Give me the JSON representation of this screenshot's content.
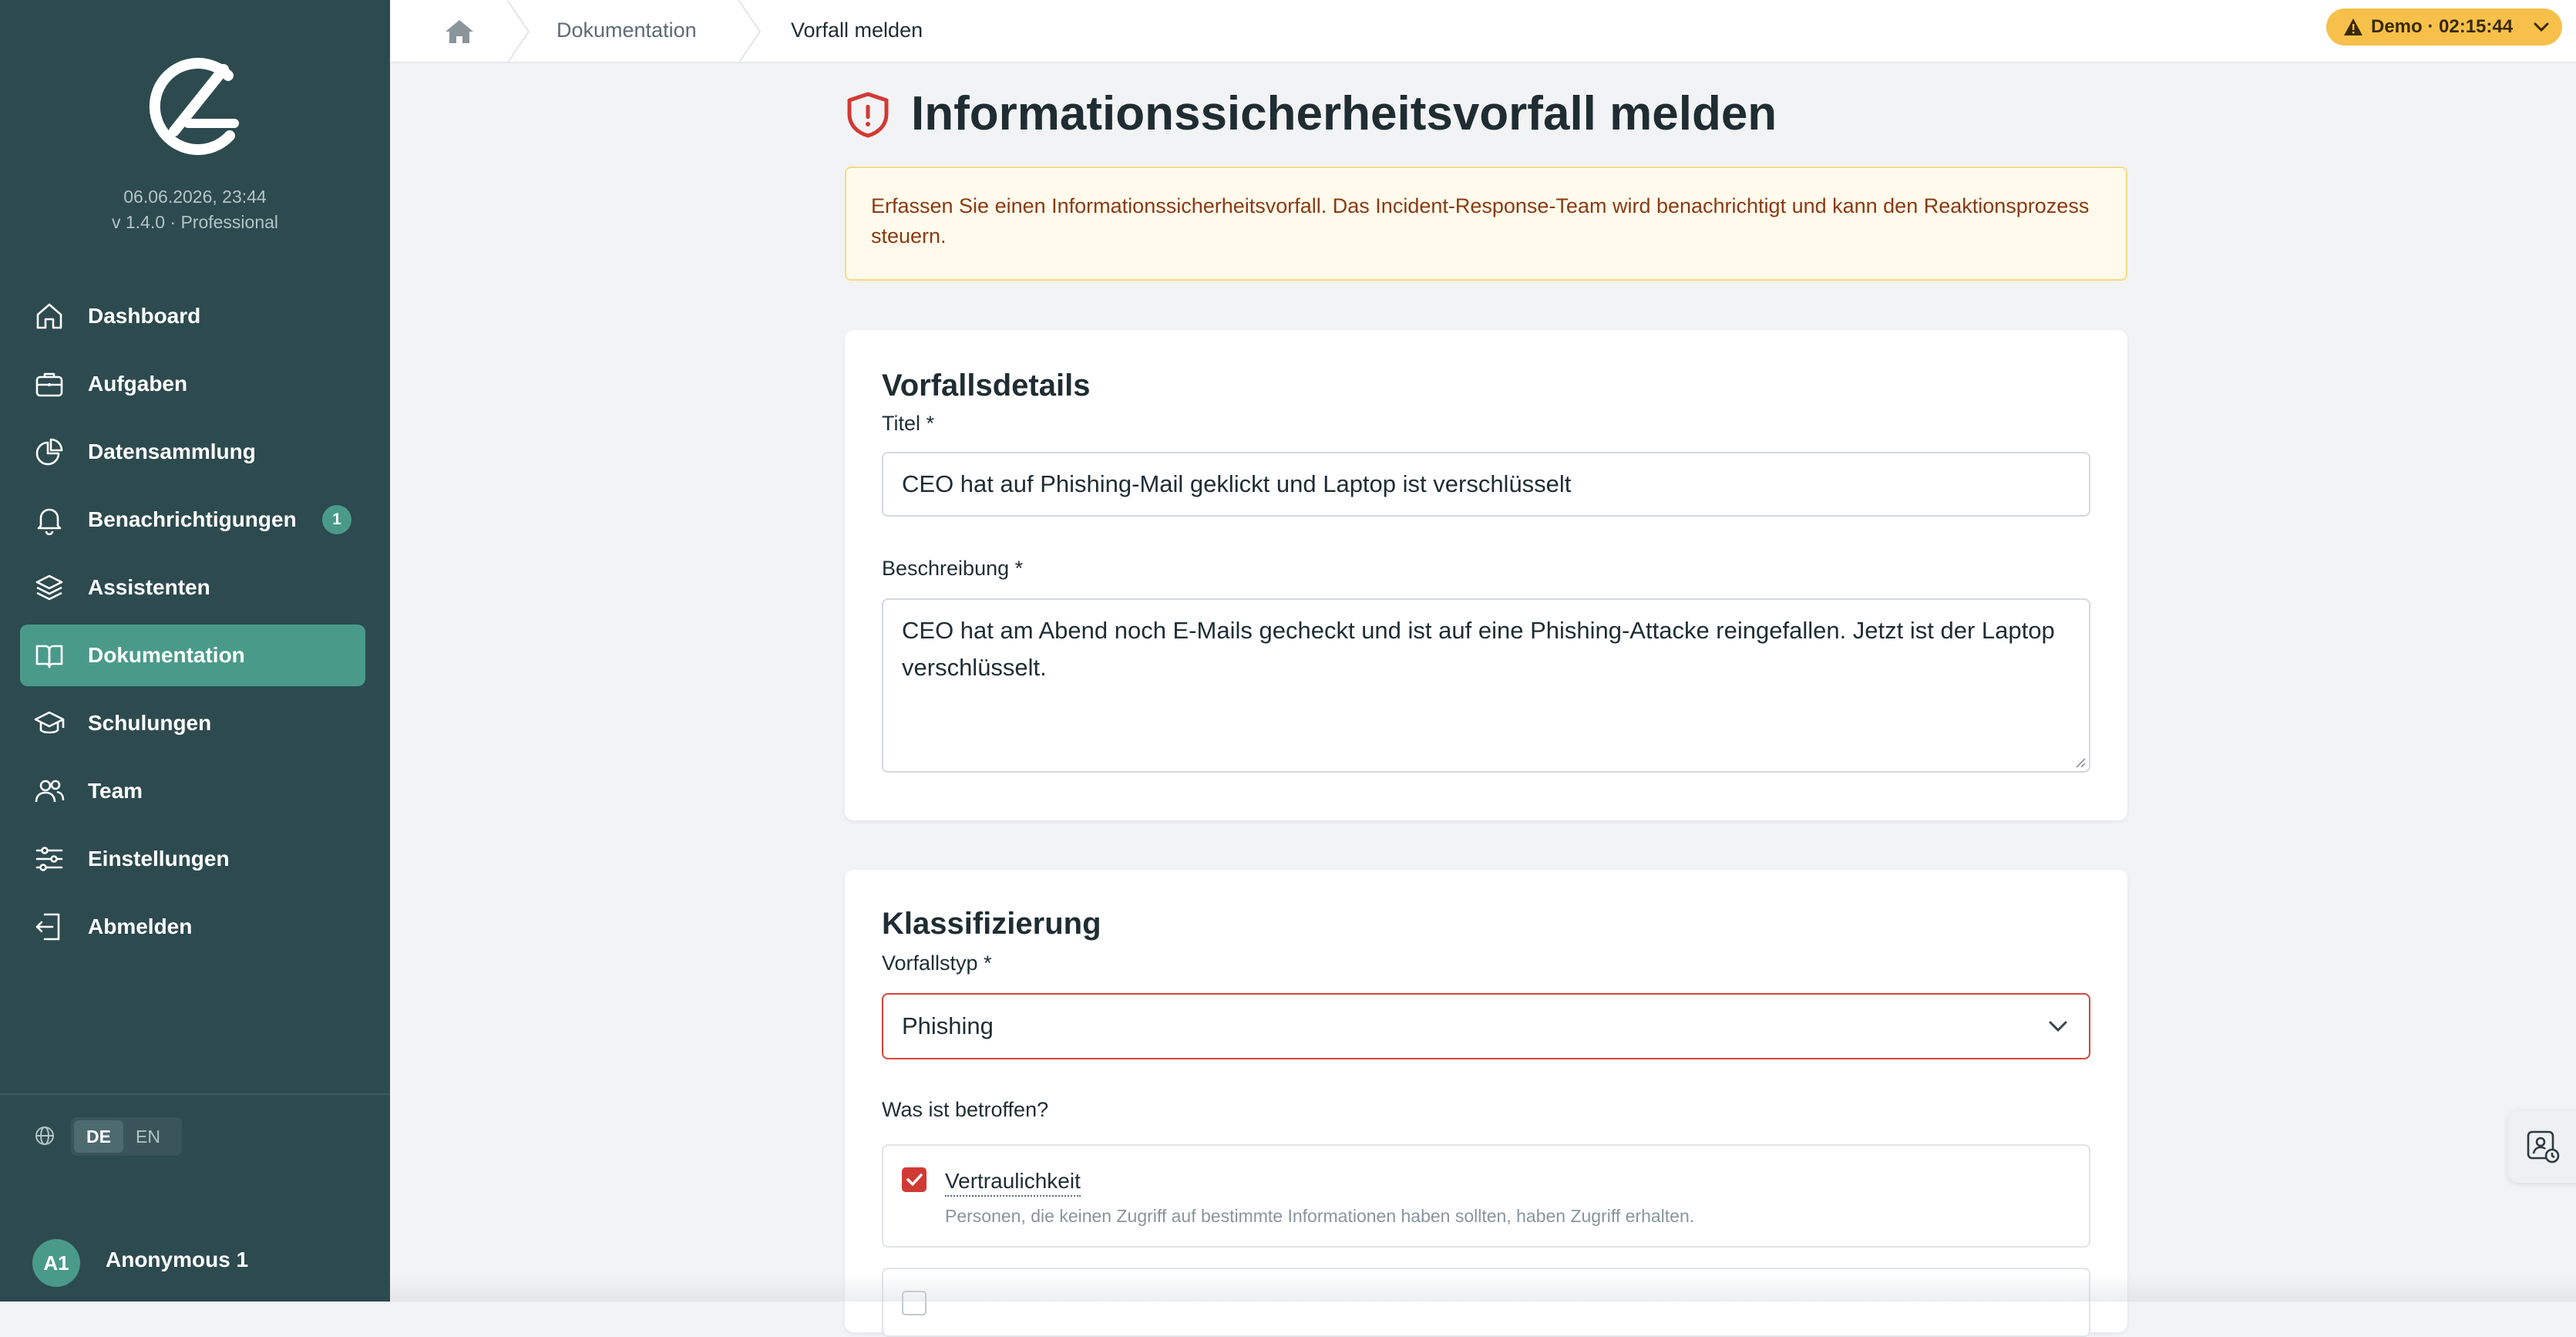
{
  "sidebar": {
    "datetime": "06.06.2026, 23:44",
    "version": "v 1.4.0 · Professional",
    "items": [
      {
        "label": "Dashboard",
        "icon": "home-icon"
      },
      {
        "label": "Aufgaben",
        "icon": "briefcase-icon"
      },
      {
        "label": "Datensammlung",
        "icon": "pie-chart-icon"
      },
      {
        "label": "Benachrichtigungen",
        "icon": "bell-icon",
        "badge": "1"
      },
      {
        "label": "Assistenten",
        "icon": "layers-icon"
      },
      {
        "label": "Dokumentation",
        "icon": "book-icon",
        "active": true
      },
      {
        "label": "Schulungen",
        "icon": "graduation-cap-icon"
      },
      {
        "label": "Team",
        "icon": "users-icon"
      },
      {
        "label": "Einstellungen",
        "icon": "sliders-icon"
      },
      {
        "label": "Abmelden",
        "icon": "logout-icon"
      }
    ],
    "languages": [
      "DE",
      "EN"
    ],
    "active_language": "DE",
    "user": {
      "initials": "A1",
      "name": "Anonymous 1"
    }
  },
  "topbar": {
    "breadcrumb": [
      "Dokumentation",
      "Vorfall melden"
    ],
    "demo_label": "Demo · 02:15:44"
  },
  "page": {
    "title": "Informationssicherheitsvorfall melden",
    "alert": "Erfassen Sie einen Informationssicherheitsvorfall. Das Incident-Response-Team wird benachrichtigt und kann den Reaktionsprozess steuern."
  },
  "details": {
    "heading": "Vorfallsdetails",
    "title_label": "Titel *",
    "title_value": "CEO hat auf Phishing-Mail geklickt und Laptop ist verschlüsselt",
    "description_label": "Beschreibung *",
    "description_value": "CEO hat am Abend noch E-Mails gecheckt und ist auf eine Phishing-Attacke reingefallen. Jetzt ist der Laptop verschlüsselt."
  },
  "classification": {
    "heading": "Klassifizierung",
    "type_label": "Vorfallstyp *",
    "type_value": "Phishing",
    "affected_label": "Was ist betroffen?",
    "options": [
      {
        "title": "Vertraulichkeit",
        "description": "Personen, die keinen Zugriff auf bestimmte Informationen haben sollten, haben Zugriff erhalten.",
        "checked": true
      }
    ]
  },
  "colors": {
    "sidebar_bg": "#2d4a4f",
    "accent": "#4a9a8a",
    "danger": "#d13a34",
    "warning": "#f6c04a"
  }
}
